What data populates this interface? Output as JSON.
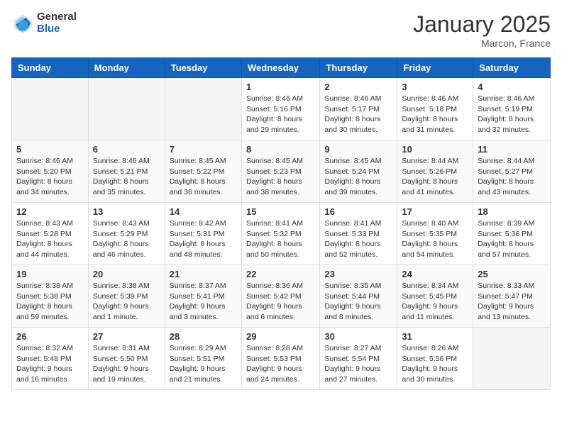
{
  "logo": {
    "general": "General",
    "blue": "Blue"
  },
  "header": {
    "month": "January 2025",
    "location": "Marcon, France"
  },
  "weekdays": [
    "Sunday",
    "Monday",
    "Tuesday",
    "Wednesday",
    "Thursday",
    "Friday",
    "Saturday"
  ],
  "weeks": [
    [
      {
        "day": "",
        "info": ""
      },
      {
        "day": "",
        "info": ""
      },
      {
        "day": "",
        "info": ""
      },
      {
        "day": "1",
        "info": "Sunrise: 8:46 AM\nSunset: 5:16 PM\nDaylight: 8 hours\nand 29 minutes."
      },
      {
        "day": "2",
        "info": "Sunrise: 8:46 AM\nSunset: 5:17 PM\nDaylight: 8 hours\nand 30 minutes."
      },
      {
        "day": "3",
        "info": "Sunrise: 8:46 AM\nSunset: 5:18 PM\nDaylight: 8 hours\nand 31 minutes."
      },
      {
        "day": "4",
        "info": "Sunrise: 8:46 AM\nSunset: 5:19 PM\nDaylight: 8 hours\nand 32 minutes."
      }
    ],
    [
      {
        "day": "5",
        "info": "Sunrise: 8:46 AM\nSunset: 5:20 PM\nDaylight: 8 hours\nand 34 minutes."
      },
      {
        "day": "6",
        "info": "Sunrise: 8:46 AM\nSunset: 5:21 PM\nDaylight: 8 hours\nand 35 minutes."
      },
      {
        "day": "7",
        "info": "Sunrise: 8:45 AM\nSunset: 5:22 PM\nDaylight: 8 hours\nand 36 minutes."
      },
      {
        "day": "8",
        "info": "Sunrise: 8:45 AM\nSunset: 5:23 PM\nDaylight: 8 hours\nand 38 minutes."
      },
      {
        "day": "9",
        "info": "Sunrise: 8:45 AM\nSunset: 5:24 PM\nDaylight: 8 hours\nand 39 minutes."
      },
      {
        "day": "10",
        "info": "Sunrise: 8:44 AM\nSunset: 5:26 PM\nDaylight: 8 hours\nand 41 minutes."
      },
      {
        "day": "11",
        "info": "Sunrise: 8:44 AM\nSunset: 5:27 PM\nDaylight: 8 hours\nand 43 minutes."
      }
    ],
    [
      {
        "day": "12",
        "info": "Sunrise: 8:43 AM\nSunset: 5:28 PM\nDaylight: 8 hours\nand 44 minutes."
      },
      {
        "day": "13",
        "info": "Sunrise: 8:43 AM\nSunset: 5:29 PM\nDaylight: 8 hours\nand 46 minutes."
      },
      {
        "day": "14",
        "info": "Sunrise: 8:42 AM\nSunset: 5:31 PM\nDaylight: 8 hours\nand 48 minutes."
      },
      {
        "day": "15",
        "info": "Sunrise: 8:41 AM\nSunset: 5:32 PM\nDaylight: 8 hours\nand 50 minutes."
      },
      {
        "day": "16",
        "info": "Sunrise: 8:41 AM\nSunset: 5:33 PM\nDaylight: 8 hours\nand 52 minutes."
      },
      {
        "day": "17",
        "info": "Sunrise: 8:40 AM\nSunset: 5:35 PM\nDaylight: 8 hours\nand 54 minutes."
      },
      {
        "day": "18",
        "info": "Sunrise: 8:39 AM\nSunset: 5:36 PM\nDaylight: 8 hours\nand 57 minutes."
      }
    ],
    [
      {
        "day": "19",
        "info": "Sunrise: 8:38 AM\nSunset: 5:38 PM\nDaylight: 8 hours\nand 59 minutes."
      },
      {
        "day": "20",
        "info": "Sunrise: 8:38 AM\nSunset: 5:39 PM\nDaylight: 9 hours\nand 1 minute."
      },
      {
        "day": "21",
        "info": "Sunrise: 8:37 AM\nSunset: 5:41 PM\nDaylight: 9 hours\nand 3 minutes."
      },
      {
        "day": "22",
        "info": "Sunrise: 8:36 AM\nSunset: 5:42 PM\nDaylight: 9 hours\nand 6 minutes."
      },
      {
        "day": "23",
        "info": "Sunrise: 8:35 AM\nSunset: 5:44 PM\nDaylight: 9 hours\nand 8 minutes."
      },
      {
        "day": "24",
        "info": "Sunrise: 8:34 AM\nSunset: 5:45 PM\nDaylight: 9 hours\nand 11 minutes."
      },
      {
        "day": "25",
        "info": "Sunrise: 8:33 AM\nSunset: 5:47 PM\nDaylight: 9 hours\nand 13 minutes."
      }
    ],
    [
      {
        "day": "26",
        "info": "Sunrise: 8:32 AM\nSunset: 5:48 PM\nDaylight: 9 hours\nand 16 minutes."
      },
      {
        "day": "27",
        "info": "Sunrise: 8:31 AM\nSunset: 5:50 PM\nDaylight: 9 hours\nand 19 minutes."
      },
      {
        "day": "28",
        "info": "Sunrise: 8:29 AM\nSunset: 5:51 PM\nDaylight: 9 hours\nand 21 minutes."
      },
      {
        "day": "29",
        "info": "Sunrise: 8:28 AM\nSunset: 5:53 PM\nDaylight: 9 hours\nand 24 minutes."
      },
      {
        "day": "30",
        "info": "Sunrise: 8:27 AM\nSunset: 5:54 PM\nDaylight: 9 hours\nand 27 minutes."
      },
      {
        "day": "31",
        "info": "Sunrise: 8:26 AM\nSunset: 5:56 PM\nDaylight: 9 hours\nand 30 minutes."
      },
      {
        "day": "",
        "info": ""
      }
    ]
  ]
}
